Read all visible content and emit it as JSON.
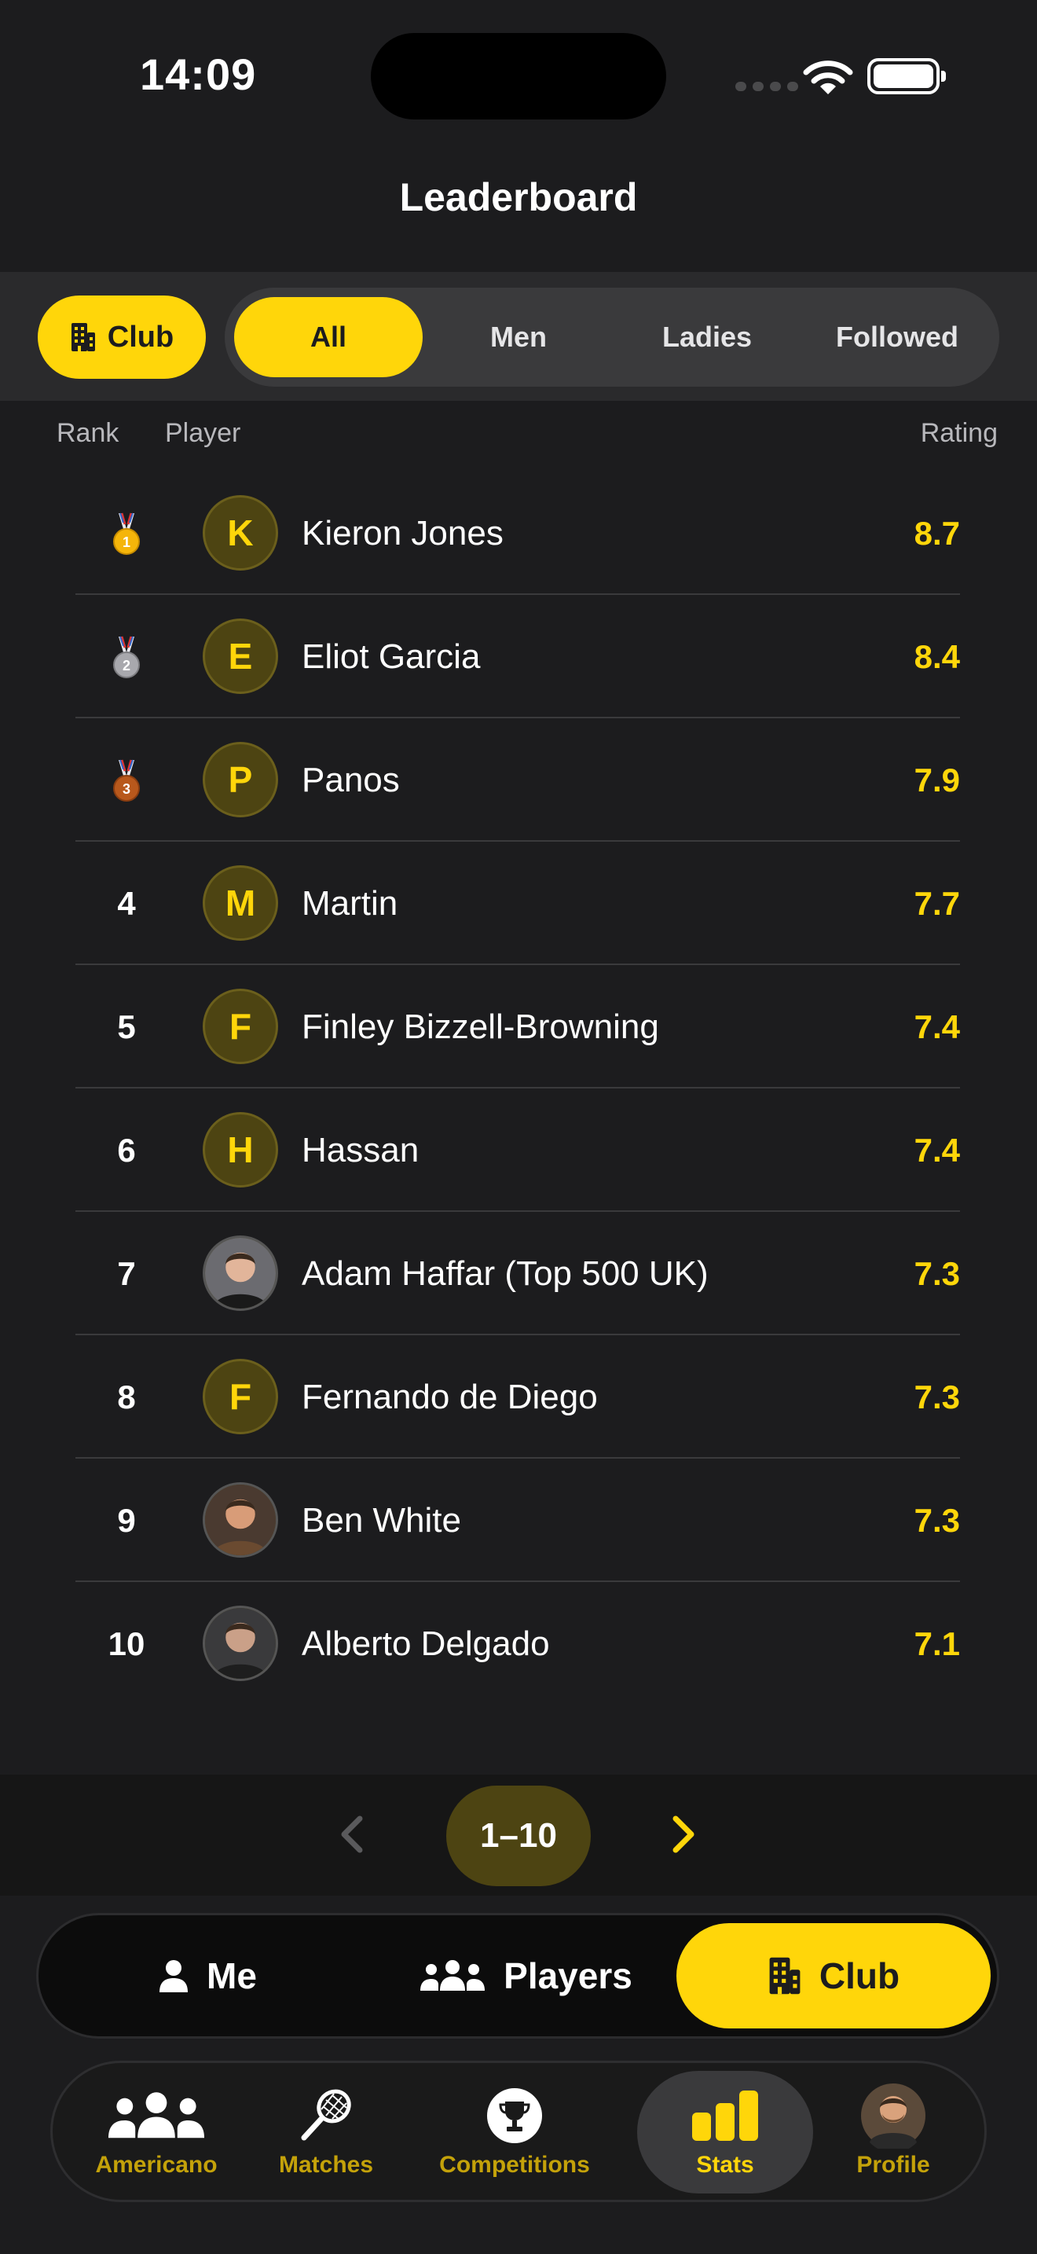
{
  "status": {
    "time": "14:09"
  },
  "header": {
    "title": "Leaderboard"
  },
  "filters": {
    "club_chip": "Club",
    "segments": [
      "All",
      "Men",
      "Ladies",
      "Followed"
    ],
    "active_segment": "All"
  },
  "columns": {
    "rank": "Rank",
    "player": "Player",
    "rating": "Rating"
  },
  "rows": [
    {
      "rank": "1",
      "medal": "gold-medal",
      "initial": "K",
      "name": "Kieron Jones",
      "rating": "8.7",
      "photo": false
    },
    {
      "rank": "2",
      "medal": "silver-medal",
      "initial": "E",
      "name": "Eliot Garcia",
      "rating": "8.4",
      "photo": false
    },
    {
      "rank": "3",
      "medal": "bronze-medal",
      "initial": "P",
      "name": "Panos",
      "rating": "7.9",
      "photo": false
    },
    {
      "rank": "4",
      "initial": "M",
      "name": "Martin",
      "rating": "7.7",
      "photo": false
    },
    {
      "rank": "5",
      "initial": "F",
      "name": "Finley Bizzell-Browning",
      "rating": "7.4",
      "photo": false
    },
    {
      "rank": "6",
      "initial": "H",
      "name": "Hassan",
      "rating": "7.4",
      "photo": false
    },
    {
      "rank": "7",
      "initial": "",
      "name": "Adam Haffar (Top 500 UK)",
      "rating": "7.3",
      "photo": true
    },
    {
      "rank": "8",
      "initial": "F",
      "name": "Fernando de Diego",
      "rating": "7.3",
      "photo": false
    },
    {
      "rank": "9",
      "initial": "",
      "name": "Ben White",
      "rating": "7.3",
      "photo": true
    },
    {
      "rank": "10",
      "initial": "",
      "name": "Alberto Delgado",
      "rating": "7.1",
      "photo": true
    }
  ],
  "pager": {
    "label": "1–10"
  },
  "scope": {
    "me": "Me",
    "players": "Players",
    "club": "Club",
    "active": "Club"
  },
  "tabs": [
    {
      "label": "Americano",
      "icon": "group-icon"
    },
    {
      "label": "Matches",
      "icon": "racket-icon"
    },
    {
      "label": "Competitions",
      "icon": "trophy-icon"
    },
    {
      "label": "Stats",
      "icon": "bar-chart-icon"
    },
    {
      "label": "Profile",
      "icon": "avatar"
    }
  ],
  "colors": {
    "accent": "#ffd60a",
    "background": "#1c1c1e",
    "avatar_bg": "#4d4412"
  }
}
